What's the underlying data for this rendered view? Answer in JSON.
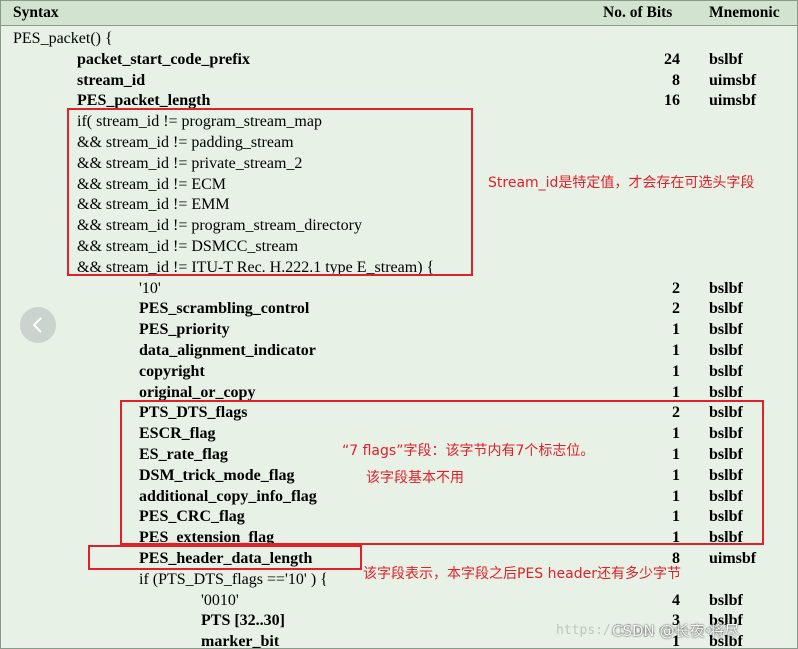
{
  "header": {
    "syntax": "Syntax",
    "bits": "No. of Bits",
    "mnemonic": "Mnemonic"
  },
  "rows": [
    {
      "syntax": "PES_packet() {",
      "bits": "",
      "mnemonic": "",
      "indent": 0,
      "bold": false
    },
    {
      "syntax": "packet_start_code_prefix",
      "bits": "24",
      "mnemonic": "bslbf",
      "indent": 1,
      "bold": true
    },
    {
      "syntax": "stream_id",
      "bits": "8",
      "mnemonic": "uimsbf",
      "indent": 1,
      "bold": true
    },
    {
      "syntax": "PES_packet_length",
      "bits": "16",
      "mnemonic": "uimsbf",
      "indent": 1,
      "bold": true
    },
    {
      "syntax": "if( stream_id != program_stream_map",
      "bits": "",
      "mnemonic": "",
      "indent": 1,
      "bold": false
    },
    {
      "syntax": "&& stream_id != padding_stream",
      "bits": "",
      "mnemonic": "",
      "indent": 1,
      "bold": false
    },
    {
      "syntax": "&& stream_id != private_stream_2",
      "bits": "",
      "mnemonic": "",
      "indent": 1,
      "bold": false
    },
    {
      "syntax": "&& stream_id != ECM",
      "bits": "",
      "mnemonic": "",
      "indent": 1,
      "bold": false
    },
    {
      "syntax": "&& stream_id != EMM",
      "bits": "",
      "mnemonic": "",
      "indent": 1,
      "bold": false
    },
    {
      "syntax": "&& stream_id != program_stream_directory",
      "bits": "",
      "mnemonic": "",
      "indent": 1,
      "bold": false
    },
    {
      "syntax": "&& stream_id != DSMCC_stream",
      "bits": "",
      "mnemonic": "",
      "indent": 1,
      "bold": false
    },
    {
      "syntax": "&& stream_id != ITU-T Rec. H.222.1 type E_stream) {",
      "bits": "",
      "mnemonic": "",
      "indent": 1,
      "bold": false
    },
    {
      "syntax": "'10'",
      "bits": "2",
      "mnemonic": "bslbf",
      "indent": 2,
      "bold": false
    },
    {
      "syntax": "PES_scrambling_control",
      "bits": "2",
      "mnemonic": "bslbf",
      "indent": 2,
      "bold": true
    },
    {
      "syntax": "PES_priority",
      "bits": "1",
      "mnemonic": "bslbf",
      "indent": 2,
      "bold": true
    },
    {
      "syntax": "data_alignment_indicator",
      "bits": "1",
      "mnemonic": "bslbf",
      "indent": 2,
      "bold": true
    },
    {
      "syntax": "copyright",
      "bits": "1",
      "mnemonic": "bslbf",
      "indent": 2,
      "bold": true
    },
    {
      "syntax": "original_or_copy",
      "bits": "1",
      "mnemonic": "bslbf",
      "indent": 2,
      "bold": true
    },
    {
      "syntax": "PTS_DTS_flags",
      "bits": "2",
      "mnemonic": "bslbf",
      "indent": 2,
      "bold": true
    },
    {
      "syntax": "ESCR_flag",
      "bits": "1",
      "mnemonic": "bslbf",
      "indent": 2,
      "bold": true
    },
    {
      "syntax": "ES_rate_flag",
      "bits": "1",
      "mnemonic": "bslbf",
      "indent": 2,
      "bold": true
    },
    {
      "syntax": "DSM_trick_mode_flag",
      "bits": "1",
      "mnemonic": "bslbf",
      "indent": 2,
      "bold": true
    },
    {
      "syntax": "additional_copy_info_flag",
      "bits": "1",
      "mnemonic": "bslbf",
      "indent": 2,
      "bold": true
    },
    {
      "syntax": "PES_CRC_flag",
      "bits": "1",
      "mnemonic": "bslbf",
      "indent": 2,
      "bold": true
    },
    {
      "syntax": "PES_extension_flag",
      "bits": "1",
      "mnemonic": "bslbf",
      "indent": 2,
      "bold": true
    },
    {
      "syntax": "PES_header_data_length",
      "bits": "8",
      "mnemonic": "uimsbf",
      "indent": 2,
      "bold": true
    },
    {
      "syntax": "if (PTS_DTS_flags =='10' ) {",
      "bits": "",
      "mnemonic": "",
      "indent": 2,
      "bold": false
    },
    {
      "syntax": "'0010'",
      "bits": "4",
      "mnemonic": "bslbf",
      "indent": 3,
      "bold": false
    },
    {
      "syntax": "PTS [32..30]",
      "bits": "3",
      "mnemonic": "bslbf",
      "indent": 3,
      "bold": true
    },
    {
      "syntax": "marker_bit",
      "bits": "1",
      "mnemonic": "bslbf",
      "indent": 3,
      "bold": true
    }
  ],
  "annotations": {
    "stream_id_note": "Stream_id是特定值，才会存在可选头字段",
    "flags_note_1": "“7 flags”字段：该字节内有7个标志位。",
    "flags_note_2": "该字段基本不用",
    "header_length_note": "该字段表示，本字段之后PES header还有多少字节"
  },
  "colors": {
    "annotation": "#e0202a",
    "table_bg": "#e7f1e6",
    "header_bg": "#d2e4cf"
  },
  "prev_button_icon": "chevron-left-icon",
  "watermark": {
    "url": "https://blog.csdn.net/",
    "text": "CSDN @长夜·将尽"
  }
}
